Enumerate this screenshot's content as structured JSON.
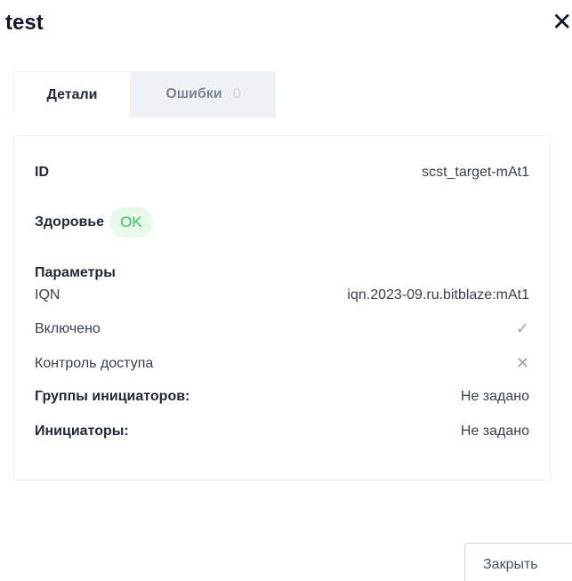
{
  "modal": {
    "title": "test",
    "close_icon": "close-icon"
  },
  "tabs": [
    {
      "label": "Детали",
      "active": true
    },
    {
      "label": "Ошибки",
      "count": "0",
      "active": false
    }
  ],
  "details": {
    "id_label": "ID",
    "id_value": "scst_target-mAt1",
    "health_label": "Здоровье",
    "health_value": "OK",
    "params_label": "Параметры",
    "iqn_label": "IQN",
    "iqn_value": "iqn.2023-09.ru.bitblaze:mAt1",
    "enabled_label": "Включено",
    "enabled_icon": "check-icon",
    "access_control_label": "Контроль доступа",
    "access_control_icon": "x-icon",
    "initiator_groups_label": "Группы инициаторов:",
    "initiator_groups_value": "Не задано",
    "initiators_label": "Инициаторы:",
    "initiators_value": "Не задано"
  },
  "footer": {
    "close_label": "Закрыть"
  },
  "colors": {
    "ok_green": "#39c655",
    "ok_bg": "#e8f9ec",
    "tab_inactive_bg": "#eef1f5"
  }
}
